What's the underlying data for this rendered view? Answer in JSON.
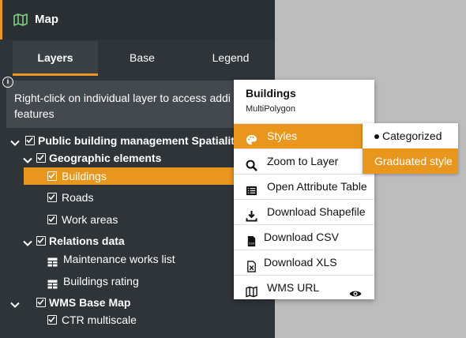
{
  "header": {
    "title": "Map",
    "icon": "map-icon"
  },
  "tabs": [
    {
      "label": "Layers",
      "active": true
    },
    {
      "label": "Base",
      "active": false
    },
    {
      "label": "Legend",
      "active": false
    }
  ],
  "info": {
    "text_line1": "Right-click on individual layer to access addi",
    "text_line2": "features"
  },
  "tree": {
    "root": {
      "label": "Public building management Spatialite",
      "checked": true,
      "expanded": true
    },
    "geographic": {
      "label": "Geographic elements",
      "checked": true,
      "expanded": true
    },
    "buildings": {
      "label": "Buildings",
      "checked": true,
      "selected": true
    },
    "roads": {
      "label": "Roads",
      "checked": true
    },
    "work_areas": {
      "label": "Work areas",
      "checked": true
    },
    "relations": {
      "label": "Relations data",
      "checked": true,
      "expanded": true
    },
    "maintenance": {
      "label": "Maintenance works list",
      "icon": "table-icon"
    },
    "rating": {
      "label": "Buildings rating",
      "icon": "table-icon"
    },
    "wms": {
      "label": "WMS Base Map",
      "checked": true,
      "expanded": true
    },
    "ctr": {
      "label": "CTR multiscale",
      "checked": true
    }
  },
  "context_menu": {
    "title": "Buildings",
    "subtitle": "MultiPolygon",
    "items": [
      {
        "label": "Styles",
        "icon": "palette-icon",
        "active": true
      },
      {
        "label": "Zoom to Layer",
        "icon": "search-icon"
      },
      {
        "label": "Open Attribute Table",
        "icon": "list-icon"
      },
      {
        "label": "Download Shapefile",
        "icon": "download-icon"
      },
      {
        "label": "Download CSV",
        "icon": "csv-file-icon"
      },
      {
        "label": "Download XLS",
        "icon": "xls-file-icon"
      },
      {
        "label": "WMS URL",
        "icon": "map-icon",
        "trailing_icon": "eye-icon"
      }
    ]
  },
  "styles_submenu": {
    "items": [
      {
        "label": "Categorized",
        "selected": true
      },
      {
        "label": "Graduated style",
        "highlighted": true
      }
    ]
  },
  "colors": {
    "accent": "#e8961e",
    "sidebar_bg": "#2f3438",
    "map_bg": "#bdbdbd"
  }
}
